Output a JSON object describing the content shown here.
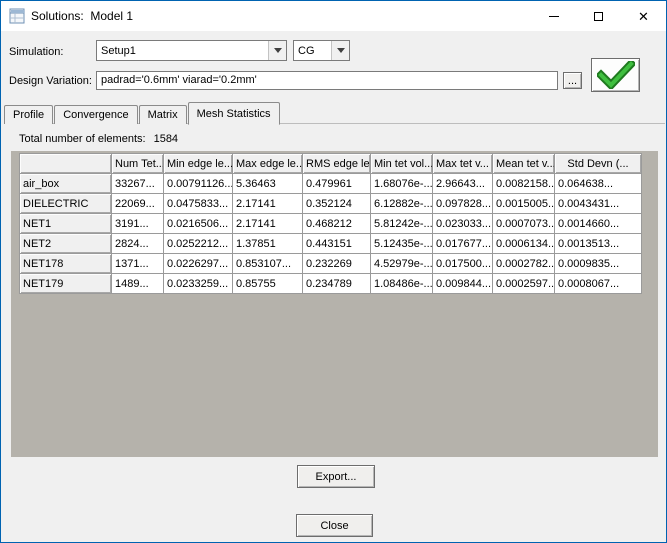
{
  "window": {
    "title": "Solutions:  Model 1"
  },
  "icons": {
    "close": "✕"
  },
  "colors": {
    "accent_border": "#0063b1",
    "check_green": "#3fbf3f",
    "grid_bg": "#b5b2ab"
  },
  "toolbar": {
    "simulation_label": "Simulation:",
    "simulation_value": "Setup1",
    "matrix_type_value": "CG",
    "design_variation_label": "Design Variation:",
    "design_variation_value": "padrad='0.6mm' viarad='0.2mm'",
    "browse_label": "..."
  },
  "tabs": [
    {
      "label": "Profile",
      "active": false
    },
    {
      "label": "Convergence",
      "active": false
    },
    {
      "label": "Matrix",
      "active": false
    },
    {
      "label": "Mesh Statistics",
      "active": true
    }
  ],
  "mesh": {
    "total_label": "Total number of elements:",
    "total_value": "1584",
    "table": {
      "columns": [
        "",
        "Num Tet...",
        "Min edge le...",
        "Max edge le...",
        "RMS edge le...",
        "Min tet vol...",
        "Max tet v...",
        "Mean tet v...",
        "Std Devn (..."
      ],
      "rows": [
        {
          "name": "air_box",
          "values": [
            "33267...",
            "0.00791126...",
            "5.36463",
            "0.479961",
            "1.68076e-...",
            "2.96643...",
            "0.0082158...",
            "0.064638..."
          ]
        },
        {
          "name": "DIELECTRIC",
          "values": [
            "22069...",
            "0.0475833...",
            "2.17141",
            "0.352124",
            "6.12882e-...",
            "0.097828...",
            "0.0015005...",
            "0.0043431..."
          ]
        },
        {
          "name": "NET1",
          "values": [
            "3191...",
            "0.0216506...",
            "2.17141",
            "0.468212",
            "5.81242e-...",
            "0.023033...",
            "0.0007073...",
            "0.0014660..."
          ]
        },
        {
          "name": "NET2",
          "values": [
            "2824...",
            "0.0252212...",
            "1.37851",
            "0.443151",
            "5.12435e-...",
            "0.017677...",
            "0.0006134...",
            "0.0013513..."
          ]
        },
        {
          "name": "NET178",
          "values": [
            "1371...",
            "0.0226297...",
            "0.853107...",
            "0.232269",
            "4.52979e-...",
            "0.017500...",
            "0.0002782...",
            "0.0009835..."
          ]
        },
        {
          "name": "NET179",
          "values": [
            "1489...",
            "0.0233259...",
            "0.85755",
            "0.234789",
            "1.08486e-...",
            "0.009844...",
            "0.0002597...",
            "0.0008067..."
          ]
        }
      ]
    }
  },
  "buttons": {
    "export": "Export...",
    "close": "Close"
  }
}
